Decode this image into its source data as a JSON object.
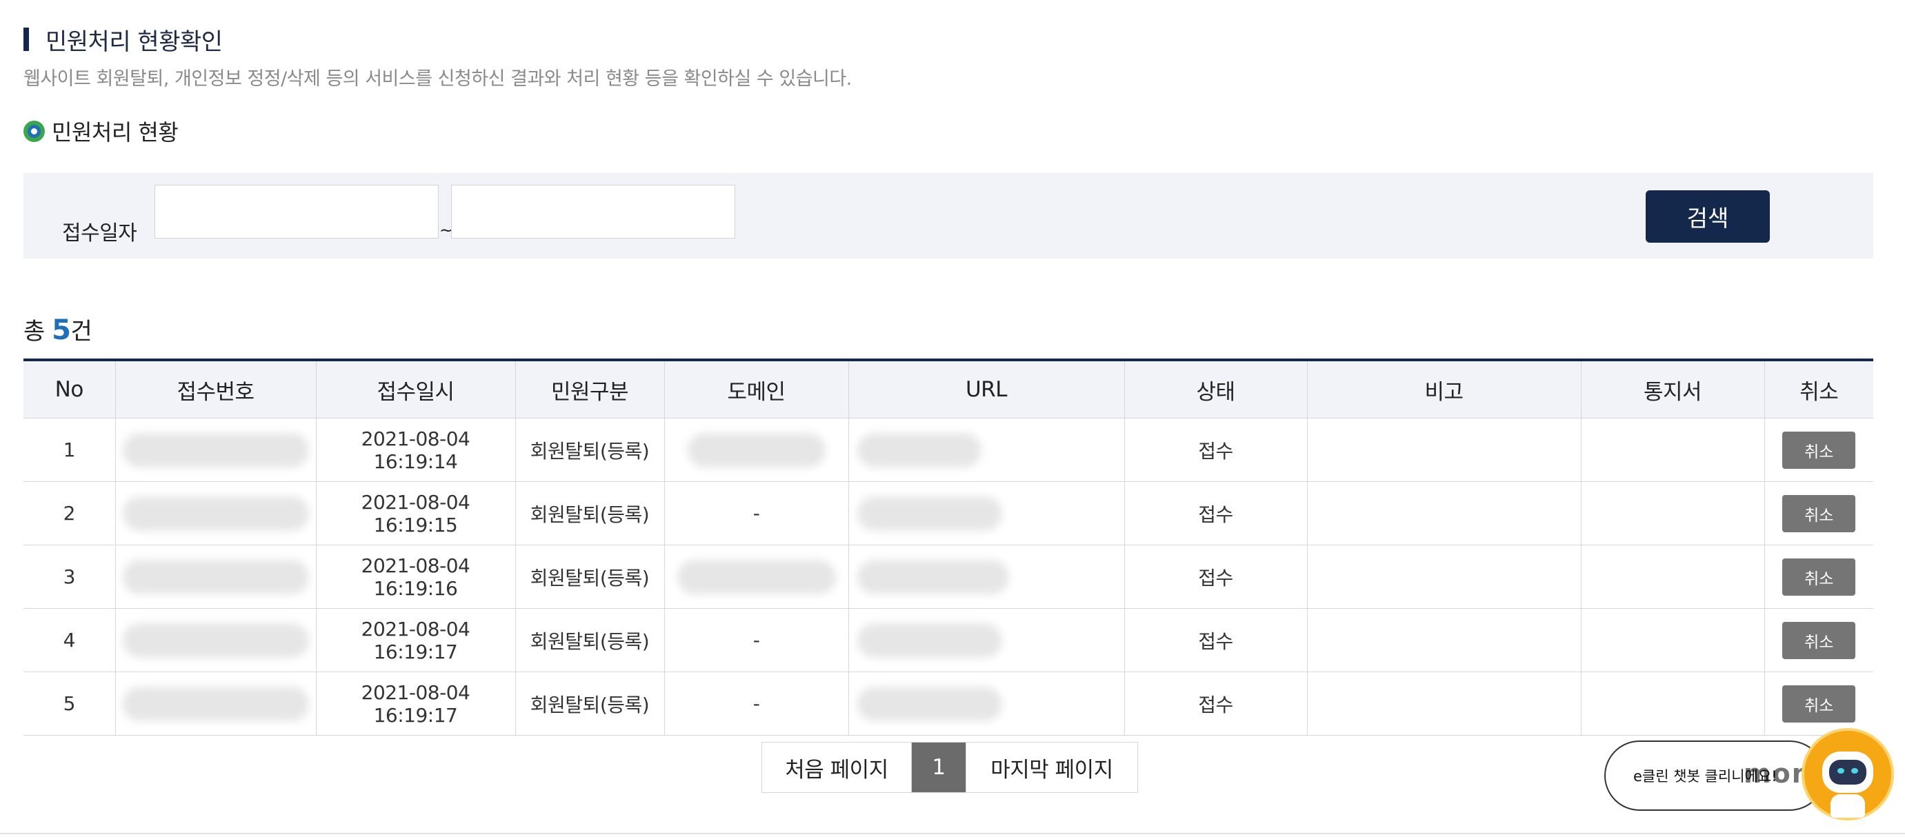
{
  "header": {
    "title": "민원처리 현황확인",
    "description": "웹사이트 회원탈퇴, 개인정보 정정/삭제 등의 서비스를 신청하신 결과와 처리 현황 등을 확인하실 수 있습니다."
  },
  "section": {
    "title": "민원처리 현황"
  },
  "search": {
    "date_label": "접수일자",
    "from_value": "",
    "to_value": "",
    "separator": "~",
    "button_label": "검색"
  },
  "summary": {
    "prefix": "총 ",
    "count": "5",
    "suffix": "건"
  },
  "table": {
    "headers": [
      "No",
      "접수번호",
      "접수일시",
      "민원구분",
      "도메인",
      "URL",
      "상태",
      "비고",
      "통지서",
      "취소"
    ],
    "rows": [
      {
        "no": "1",
        "datetime": "2021-08-04 16:19:14",
        "type": "회원탈퇴(등록)",
        "domain": "",
        "status": "접수",
        "note": "",
        "notice": "",
        "cancel_label": "취소"
      },
      {
        "no": "2",
        "datetime": "2021-08-04 16:19:15",
        "type": "회원탈퇴(등록)",
        "domain": "-",
        "status": "접수",
        "note": "",
        "notice": "",
        "cancel_label": "취소"
      },
      {
        "no": "3",
        "datetime": "2021-08-04 16:19:16",
        "type": "회원탈퇴(등록)",
        "domain": "",
        "status": "접수",
        "note": "",
        "notice": "",
        "cancel_label": "취소"
      },
      {
        "no": "4",
        "datetime": "2021-08-04 16:19:17",
        "type": "회원탈퇴(등록)",
        "domain": "-",
        "status": "접수",
        "note": "",
        "notice": "",
        "cancel_label": "취소"
      },
      {
        "no": "5",
        "datetime": "2021-08-04 16:19:17",
        "type": "회원탈퇴(등록)",
        "domain": "-",
        "status": "접수",
        "note": "",
        "notice": "",
        "cancel_label": "취소"
      }
    ]
  },
  "pagination": {
    "first_label": "처음 페이지",
    "current_page": "1",
    "last_label": "마지막 페이지"
  },
  "chatbot": {
    "bubble_text": "e클린 챗봇 클리니에요!",
    "logo_text": "monium",
    "icon": "robot-icon"
  },
  "colors": {
    "accent_navy": "#14284b",
    "count_blue": "#1f6fb8",
    "header_bg": "#f1f3f8",
    "cancel_gray": "#757575",
    "chatbot_orange": "#f6a714"
  }
}
